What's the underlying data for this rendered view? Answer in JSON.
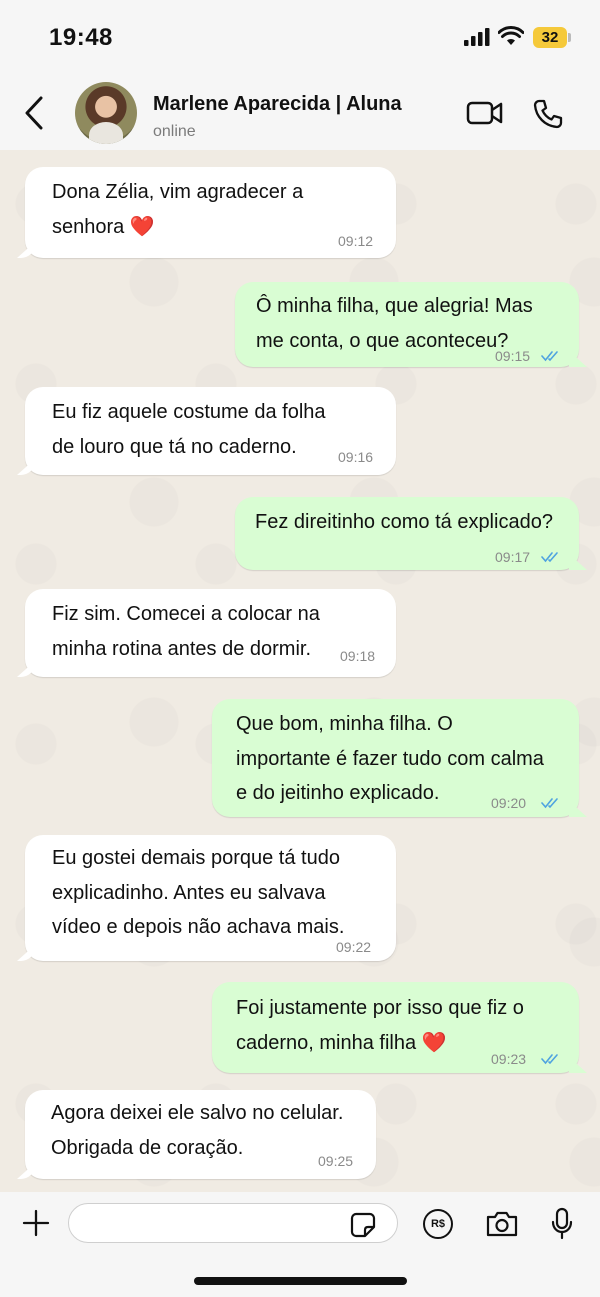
{
  "status_bar": {
    "time": "19:48",
    "battery": "32"
  },
  "header": {
    "contact_name": "Marlene Aparecida | Aluna",
    "contact_status": "online"
  },
  "messages": [
    {
      "direction": "in",
      "text": "Dona Zélia, vim agradecer a\nsenhora ❤️",
      "time": "09:12"
    },
    {
      "direction": "out",
      "text": "Ô minha filha, que alegria! Mas\nme conta, o que aconteceu?",
      "time": "09:15",
      "status": "read"
    },
    {
      "direction": "in",
      "text": "Eu fiz aquele costume da folha\nde louro que tá no caderno.",
      "time": "09:16"
    },
    {
      "direction": "out",
      "text": "Fez direitinho como tá explicado?",
      "time": "09:17",
      "status": "read"
    },
    {
      "direction": "in",
      "text": "Fiz sim. Comecei a colocar na\nminha rotina antes de dormir.",
      "time": "09:18"
    },
    {
      "direction": "out",
      "text": "Que bom, minha filha. O\nimportante é fazer tudo com calma\ne do jeitinho explicado.",
      "time": "09:20",
      "status": "read"
    },
    {
      "direction": "in",
      "text": "Eu gostei demais porque tá tudo\nexplicadinho. Antes eu salvava\nvídeo e depois não achava mais.",
      "time": "09:22"
    },
    {
      "direction": "out",
      "text": "Foi justamente por isso que fiz o\ncaderno, minha filha ❤️",
      "time": "09:23",
      "status": "read"
    },
    {
      "direction": "in",
      "text": "Agora deixei ele salvo no celular.\nObrigada de coração.",
      "time": "09:25"
    }
  ],
  "input_bar": {
    "message_value": "",
    "pix_label": "R$"
  },
  "colors": {
    "incoming_bubble": "#ffffff",
    "outgoing_bubble": "#d9fdd3",
    "chat_background": "#f0ebe3",
    "read_ticks": "#4fa3e0",
    "battery": "#f5c93a"
  }
}
